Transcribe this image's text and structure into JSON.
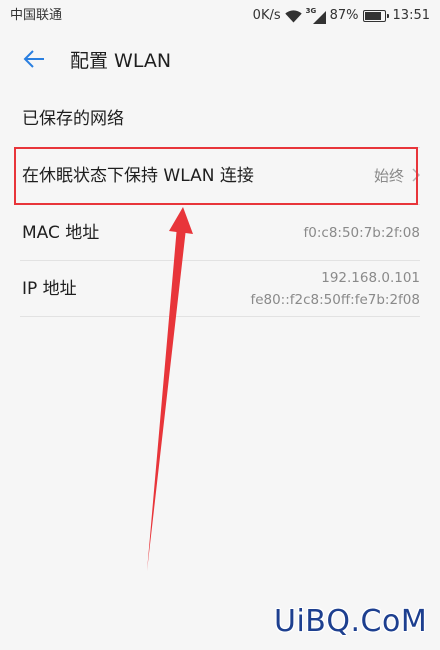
{
  "status_bar": {
    "carrier": "中国联通",
    "net_speed": "0K/s",
    "network_type": "3G",
    "battery": "87%",
    "battery_level": 0.87,
    "time": "13:51"
  },
  "header": {
    "title": "配置 WLAN"
  },
  "saved_networks": {
    "label": "已保存的网络"
  },
  "sleep_policy": {
    "label": "在休眠状态下保持 WLAN 连接",
    "value": "始终"
  },
  "mac": {
    "label": "MAC 地址",
    "value": "f0:c8:50:7b:2f:08"
  },
  "ip": {
    "label": "IP 地址",
    "ipv4": "192.168.0.101",
    "ipv6": "fe80::f2c8:50ff:fe7b:2f08"
  },
  "watermark": "UiBQ.CoM",
  "icons": {
    "back": "back-arrow-icon",
    "wifi": "wifi-icon",
    "signal": "signal-icon",
    "battery": "battery-icon",
    "chevron": "chevron-right-icon"
  },
  "colors": {
    "background": "#f6f6f6",
    "accent": "#2a7fe0",
    "text": "#1f1f1f",
    "secondary_text": "#8a8a8a",
    "divider": "#e2e2e2",
    "annotation": "#e8353a",
    "watermark": "#1d3f8f"
  }
}
